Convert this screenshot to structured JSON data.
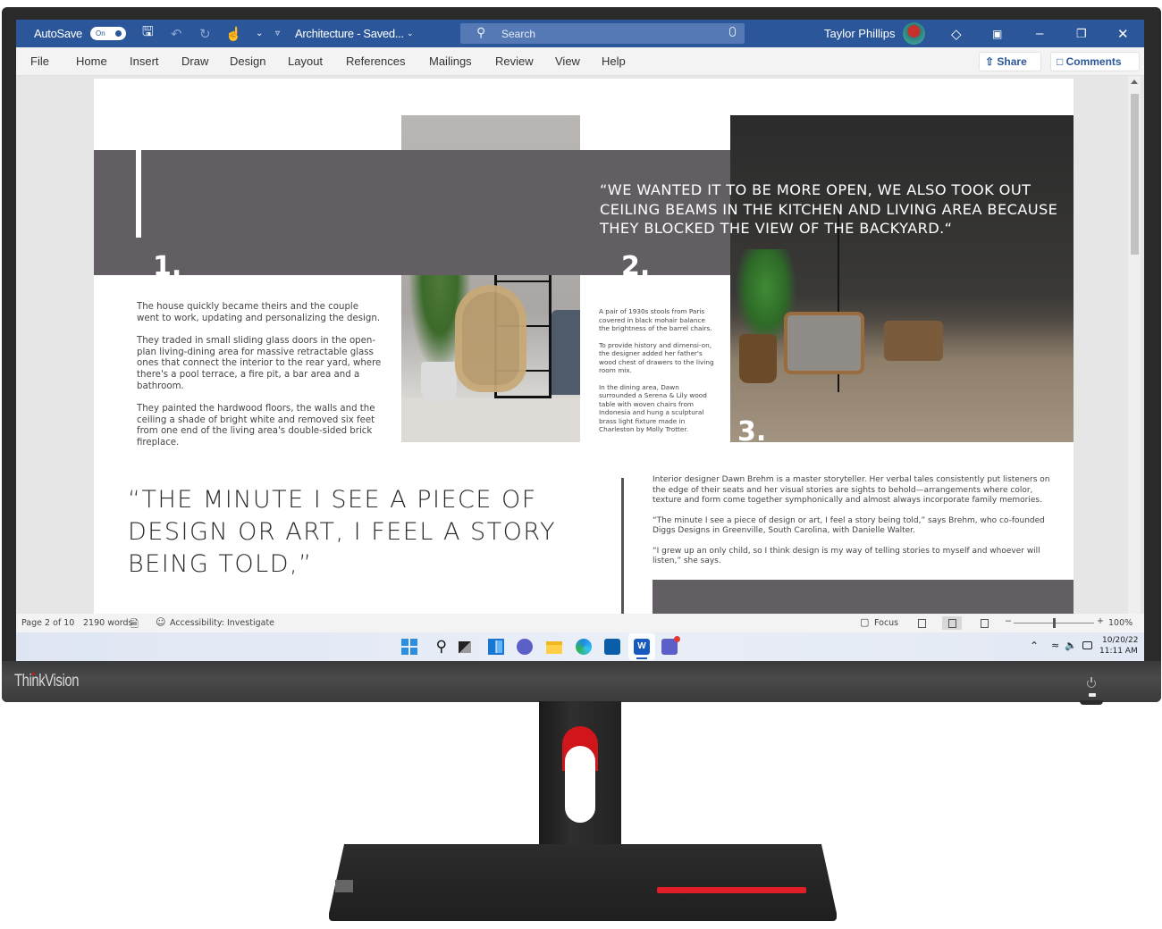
{
  "monitor": {
    "brand": "ThinkVision",
    "accent_red": "#e11e25"
  },
  "titlebar": {
    "autosave_label": "AutoSave",
    "autosave_state": "On",
    "document_title": "Architecture - Saved...",
    "search_placeholder": "Search",
    "user_name": "Taylor Phillips",
    "bar_color": "#2b579a"
  },
  "ribbon": {
    "tabs": [
      "File",
      "Home",
      "Insert",
      "Draw",
      "Design",
      "Layout",
      "References",
      "Mailings",
      "Review",
      "View",
      "Help"
    ],
    "share_label": "Share",
    "comments_label": "Comments"
  },
  "document": {
    "section_numbers": [
      "1.",
      "2.",
      "3."
    ],
    "column1": [
      "The house quickly became theirs and the couple went to work, updating and personalizing the design.",
      "They traded in small sliding glass doors in the open-plan living-dining area for massive retractable glass ones that connect the interior to the rear yard, where there's a pool terrace, a fire pit, a bar area and a bathroom.",
      " They painted the hardwood floors, the walls and the ceiling a shade of bright white and removed six feet from one end of the living area's double-sided brick fireplace."
    ],
    "column2": [
      "A pair of 1930s stools from Paris covered in black mohair balance the brightness of the barrel chairs.",
      "To provide history and dimensi-on, the designer added her father's wood chest of drawers to the living room mix.",
      "In the dining area, Dawn surrounded a Serena & Lily wood table with woven chairs from Indonesia and hung a sculptural brass light fixture made in Charleston by Molly Trotter."
    ],
    "overlay_quote": "“WE WANTED IT TO BE MORE OPEN, WE ALSO TOOK OUT CEILING BEAMS IN THE KITCHEN AND LIVING AREA BECAUSE THEY BLOCKED THE VIEW OF THE BACKYARD.“",
    "big_quote": "“THE MINUTE I SEE A PIECE OF DESIGN OR ART, I FEEL A STORY BEING TOLD,”",
    "column3": [
      "Interior designer Dawn Brehm is a master storyteller. Her verbal tales consistently put listeners on the edge of their seats and her visual stories are sights to behold—arrangements where color, texture and form come together symphonically and almost always incorporate family memories.",
      "“The minute I see a piece of design or art, I feel a story being told,” says Brehm, who co-founded Diggs Designs in Greenville, South Carolina, with Danielle Walter.",
      "“I grew up an only child, so I think design is my way of telling stories to myself and whoever will listen,” she says."
    ]
  },
  "statusbar": {
    "page_info": "Page 2 of 10",
    "word_count": "2190 words",
    "accessibility": "Accessibility: Investigate",
    "focus_label": "Focus",
    "zoom_minus": "−",
    "zoom_plus": "+",
    "zoom_level": "100%",
    "zoom_percent": 100
  },
  "taskbar": {
    "apps": [
      "start",
      "search",
      "task-view",
      "widgets",
      "chat",
      "file-explorer",
      "edge",
      "store",
      "word",
      "teams"
    ],
    "active_app": "word",
    "date": "10/20/22",
    "time": "11:11 AM"
  }
}
